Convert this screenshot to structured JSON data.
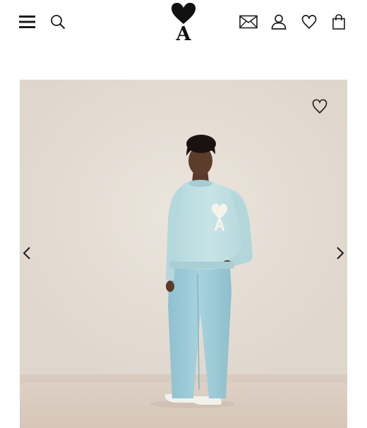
{
  "header": {
    "icons": {
      "menu": "hamburger-menu-icon",
      "search": "search-icon",
      "logo": "brand-heart-a-logo",
      "contact": "mail-icon",
      "account": "user-icon",
      "wishlist": "heart-icon",
      "bag": "shopping-bag-icon"
    },
    "logo_letter": "A"
  },
  "gallery": {
    "favorite_icon": "heart-outline-icon",
    "prev_icon": "chevron-left-icon",
    "next_icon": "chevron-right-icon"
  },
  "colors": {
    "icon": "#1c1c1c",
    "background_wall": "#e6ded5",
    "sweater": "#bfe0e2",
    "trousers": "#9ccbd6"
  }
}
